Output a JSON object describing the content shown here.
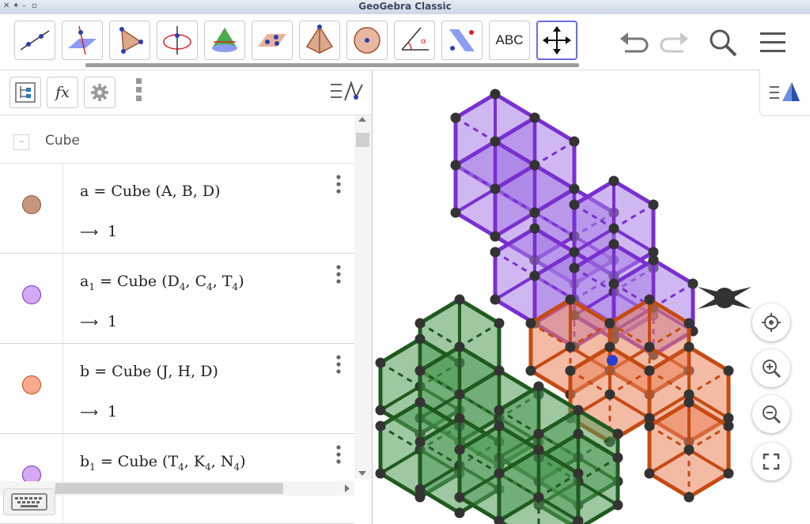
{
  "window": {
    "title": "GeoGebra Classic"
  },
  "toolbar": {
    "tools": [
      {
        "icon": "line-tool-icon"
      },
      {
        "icon": "perpendicular-plane-tool-icon"
      },
      {
        "icon": "polygon-tool-icon"
      },
      {
        "icon": "circle-around-line-tool-icon"
      },
      {
        "icon": "cone-tool-icon"
      },
      {
        "icon": "plane-through-points-tool-icon"
      },
      {
        "icon": "pyramid-tool-icon"
      },
      {
        "icon": "sphere-tool-icon"
      },
      {
        "icon": "angle-tool-icon"
      },
      {
        "icon": "reflect-about-plane-tool-icon"
      },
      {
        "icon": "text-tool-icon",
        "label": "ABC"
      },
      {
        "icon": "move-tool-icon"
      }
    ],
    "undo": "undo-icon",
    "redo": "redo-icon",
    "search": "search-icon",
    "menu": "menu-icon"
  },
  "algebra": {
    "group_name": "Cube",
    "rows": [
      {
        "name": "a",
        "sub": "",
        "eq": " = Cube",
        "args": [
          [
            "A",
            ""
          ],
          [
            "B",
            ""
          ],
          [
            "D",
            ""
          ]
        ],
        "value": "1",
        "color": "#c6957f"
      },
      {
        "name": "a",
        "sub": "1",
        "eq": " = Cube",
        "args": [
          [
            "D",
            "4"
          ],
          [
            "C",
            "4"
          ],
          [
            "T",
            "4"
          ]
        ],
        "value": "1",
        "color": "#d3a8f5"
      },
      {
        "name": "b",
        "sub": "",
        "eq": " = Cube",
        "args": [
          [
            "J",
            ""
          ],
          [
            "H",
            ""
          ],
          [
            "D",
            ""
          ]
        ],
        "value": "1",
        "color": "#f7ab8e"
      },
      {
        "name": "b",
        "sub": "1",
        "eq": " = Cube",
        "args": [
          [
            "T",
            "4"
          ],
          [
            "K",
            "4"
          ],
          [
            "N",
            "4"
          ]
        ],
        "value": "",
        "color": "#d3a8f5"
      }
    ],
    "arrow": "⟶"
  },
  "colors": {
    "purple_fill": "#a77de6",
    "purple_edge": "#7a2fd0",
    "orange_fill": "#e9835a",
    "orange_edge": "#c64a12",
    "green_fill": "#4f9a55",
    "green_edge": "#1f5a1e",
    "accent": "#6b6ce0"
  }
}
